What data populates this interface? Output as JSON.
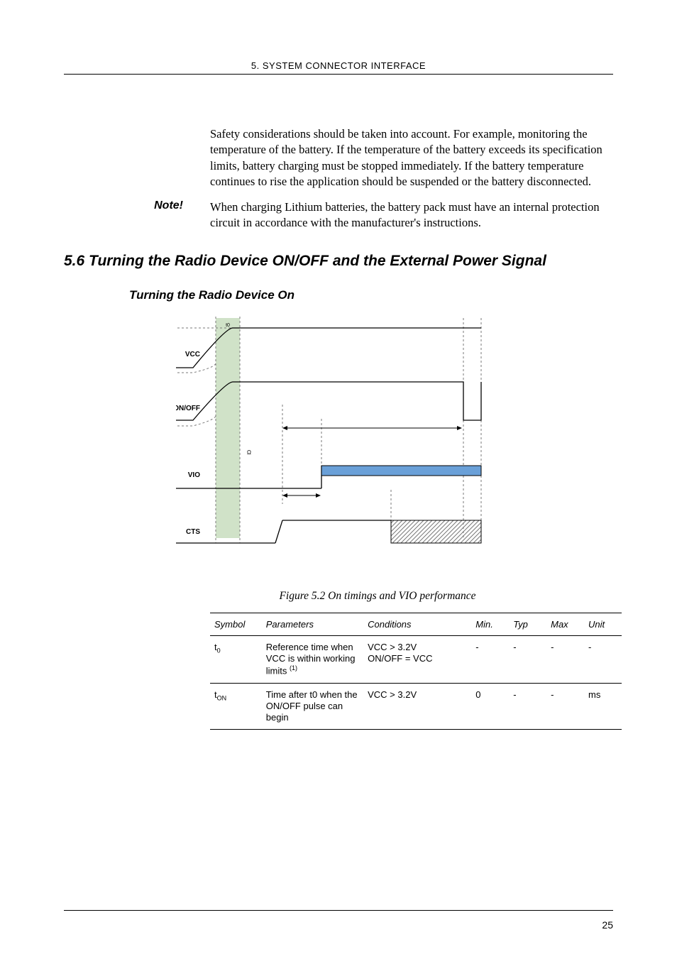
{
  "header": "5. SYSTEM CONNECTOR INTERFACE",
  "body": {
    "para1": "Safety considerations should be taken into account. For example, monitoring the temperature of the battery. If the temperature of the battery exceeds its specification limits, battery charging must be stopped immediately. If the battery temperature continues to rise the application should be suspended or the battery disconnected.",
    "noteLabel": "Note!",
    "noteText": "When charging Lithium batteries, the battery pack must have an internal protection circuit in accordance with the manufacturer's instructions."
  },
  "section": {
    "heading": "5.6 Turning the Radio Device ON/OFF and the External Power Signal",
    "subheading": "Turning the Radio Device On"
  },
  "diagram": {
    "labels": {
      "vcc": "VCC",
      "onoff": "ON/OFF",
      "vio": "VIO",
      "cts": "CTS",
      "unit": "Ω"
    }
  },
  "figureCaption": "Figure 5.2  On timings and VIO performance",
  "table": {
    "headers": [
      "Symbol",
      "Parameters",
      "Conditions",
      "Min.",
      "Typ",
      "Max",
      "Unit"
    ],
    "rows": [
      {
        "symbol_base": "t",
        "symbol_sub": "0",
        "parameters_pre": "Reference time when VCC is within working limits ",
        "parameters_sup": "(1)",
        "conditions": "VCC > 3.2V\nON/OFF = VCC",
        "min": "-",
        "typ": "-",
        "max": "-",
        "unit": "-"
      },
      {
        "symbol_base": "t",
        "symbol_sub": "ON",
        "parameters_pre": "Time after t0 when the ON/OFF pulse can begin",
        "parameters_sup": "",
        "conditions": "VCC > 3.2V",
        "min": "0",
        "typ": "-",
        "max": "-",
        "unit": "ms"
      }
    ]
  },
  "pageNumber": "25",
  "chart_data": {
    "type": "timing-diagram",
    "title": "On timings and VIO performance",
    "signals": [
      {
        "name": "VCC",
        "description": "ramps low to high, crosses threshold at t0"
      },
      {
        "name": "ON/OFF",
        "description": "ramps with VCC then high, later pulses low"
      },
      {
        "name": "VIO",
        "description": "low then steps high after delay"
      },
      {
        "name": "CTS",
        "description": "low then high, later hatched region"
      }
    ],
    "marker": "t0 aligned with VCC crossing 3.2V and ON/OFF reaching VCC"
  }
}
